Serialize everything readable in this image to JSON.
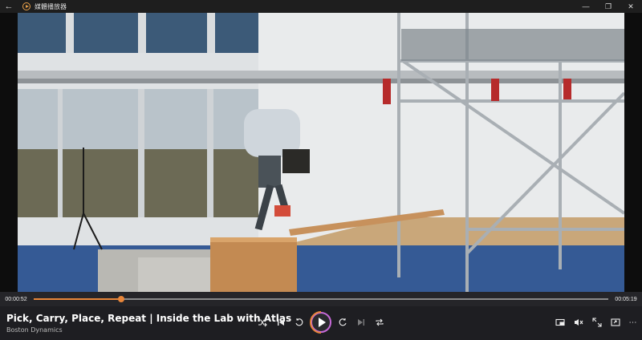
{
  "titlebar": {
    "app_title": "媒體播放器"
  },
  "player": {
    "current_time": "00:00:52",
    "total_time": "00:05:19",
    "progress_fraction": 0.152,
    "video_title": "Pick, Carry, Place, Repeat | Inside the Lab with Atlas",
    "channel": "Boston Dynamics"
  },
  "colors": {
    "accent": "#e8863a",
    "accent2": "#c76ad9"
  },
  "icons": {
    "back": "back-arrow-icon",
    "app": "media-player-app-icon",
    "shuffle": "shuffle-icon",
    "previous": "previous-icon",
    "rewind": "rewind-10-icon",
    "play": "play-icon",
    "forward": "forward-30-icon",
    "next": "next-icon",
    "repeat": "repeat-icon",
    "miniplayer": "mini-player-icon",
    "volume": "volume-mute-icon",
    "fullscreen": "fullscreen-icon",
    "more": "more-options-icon"
  }
}
